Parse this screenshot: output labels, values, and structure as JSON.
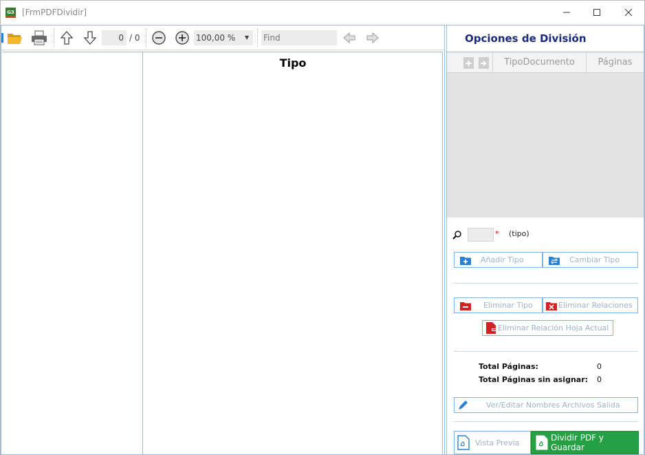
{
  "window": {
    "icon_text": "G3",
    "title": "[FrmPDFDividir]"
  },
  "toolbar": {
    "page_current": "0",
    "page_total": "/ 0",
    "zoom": "100,00 %",
    "find_placeholder": "Find"
  },
  "document": {
    "title": "Tipo"
  },
  "options": {
    "title": "Opciones de División",
    "grid": {
      "columns": [
        "TipoDocumento",
        "Páginas"
      ],
      "rows": []
    },
    "search": {
      "required_mark": "*",
      "label": "(tipo)"
    },
    "buttons": {
      "add_type": "Añadir Tipo",
      "change_type": "Cambiar Tipo",
      "delete_type": "Eliminar Tipo",
      "delete_relations": "Eliminar Relaciones",
      "delete_current_relation": "Eliminar Relación Hoja Actual",
      "edit_names": "Ver/Editar Nombres Archivos Salida",
      "preview": "Vista Previa",
      "split_save": "Dividir PDF y Guardar"
    },
    "totals": {
      "total_pages_label": "Total Páginas:",
      "total_pages_value": "0",
      "unassigned_label": "Total Páginas sin asignar:",
      "unassigned_value": "0"
    }
  },
  "colors": {
    "accent_blue": "#2b7fd0",
    "border_blue": "#99bbdd",
    "delete_red": "#d42020",
    "success_green": "#27a045",
    "title_navy": "#1a2a7a"
  }
}
